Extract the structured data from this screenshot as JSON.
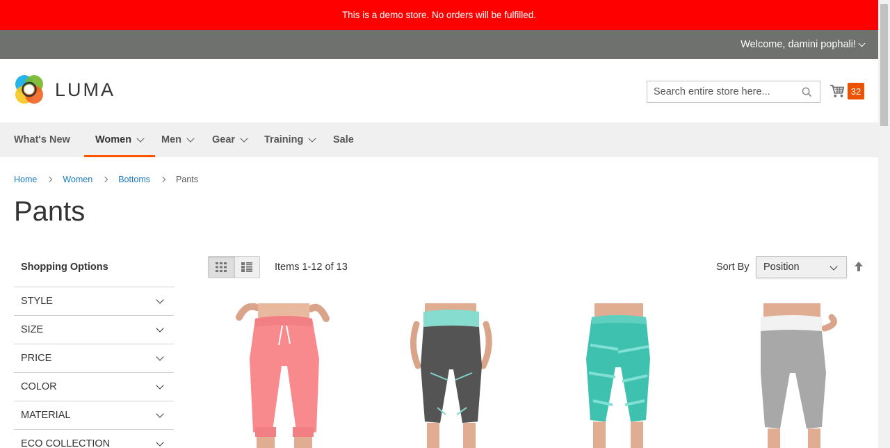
{
  "banner": {
    "text": "This is a demo store. No orders will be fulfilled."
  },
  "header": {
    "welcome": "Welcome, damini pophali!",
    "logo_text": "LUMA",
    "search_placeholder": "Search entire store here...",
    "cart_count": "32"
  },
  "nav": {
    "items": [
      {
        "label": "What's New"
      },
      {
        "label": "Women"
      },
      {
        "label": "Men"
      },
      {
        "label": "Gear"
      },
      {
        "label": "Training"
      },
      {
        "label": "Sale"
      }
    ],
    "active": "Women"
  },
  "breadcrumb": {
    "items": [
      {
        "label": "Home"
      },
      {
        "label": "Women"
      },
      {
        "label": "Bottoms"
      }
    ],
    "current": "Pants"
  },
  "page_title": "Pants",
  "sidebar": {
    "title": "Shopping Options",
    "filters": [
      "STYLE",
      "SIZE",
      "PRICE",
      "COLOR",
      "MATERIAL",
      "ECO COLLECTION"
    ]
  },
  "toolbar": {
    "items_count": "Items 1-12 of 13",
    "sort_label": "Sort By",
    "sort_value": "Position"
  },
  "colors": {
    "banner": "#ff0000",
    "panel": "#6e716e",
    "accent": "#ff5501",
    "cart_badge": "#eb5202",
    "link": "#1979c3"
  }
}
